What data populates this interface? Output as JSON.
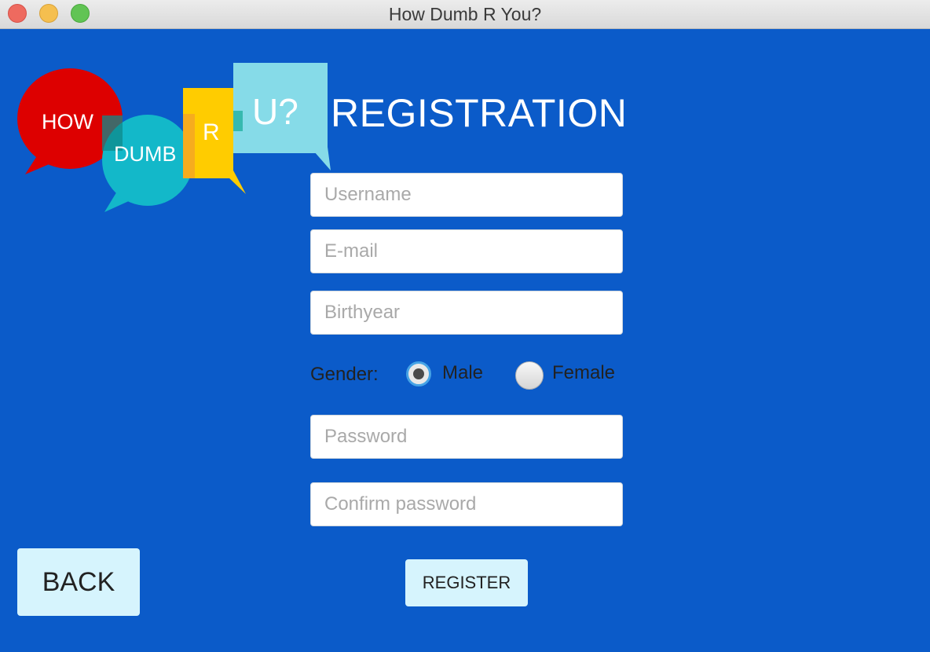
{
  "window": {
    "title": "How Dumb R You?"
  },
  "logo": {
    "bubble_how": "HOW",
    "bubble_dumb": "DUMB",
    "bubble_r": "R",
    "bubble_u": "U?",
    "colors": {
      "how": "#dd0000",
      "dumb": "#13b8c9",
      "r": "#ffcc00",
      "u": "#86dbe8"
    }
  },
  "page": {
    "title": "REGISTRATION"
  },
  "form": {
    "username": {
      "value": "",
      "placeholder": "Username"
    },
    "email": {
      "value": "",
      "placeholder": "E-mail"
    },
    "birthyear": {
      "value": "",
      "placeholder": "Birthyear"
    },
    "gender": {
      "label": "Gender:",
      "options": [
        {
          "label": "Male",
          "selected": true
        },
        {
          "label": "Female",
          "selected": false
        }
      ]
    },
    "password": {
      "value": "",
      "placeholder": "Password"
    },
    "confirm_password": {
      "value": "",
      "placeholder": "Confirm password"
    }
  },
  "buttons": {
    "back": "BACK",
    "register": "REGISTER"
  },
  "colors": {
    "background": "#0b5bc9",
    "button_bg": "#d6f4fd",
    "radio_focus": "#45a3e6"
  }
}
